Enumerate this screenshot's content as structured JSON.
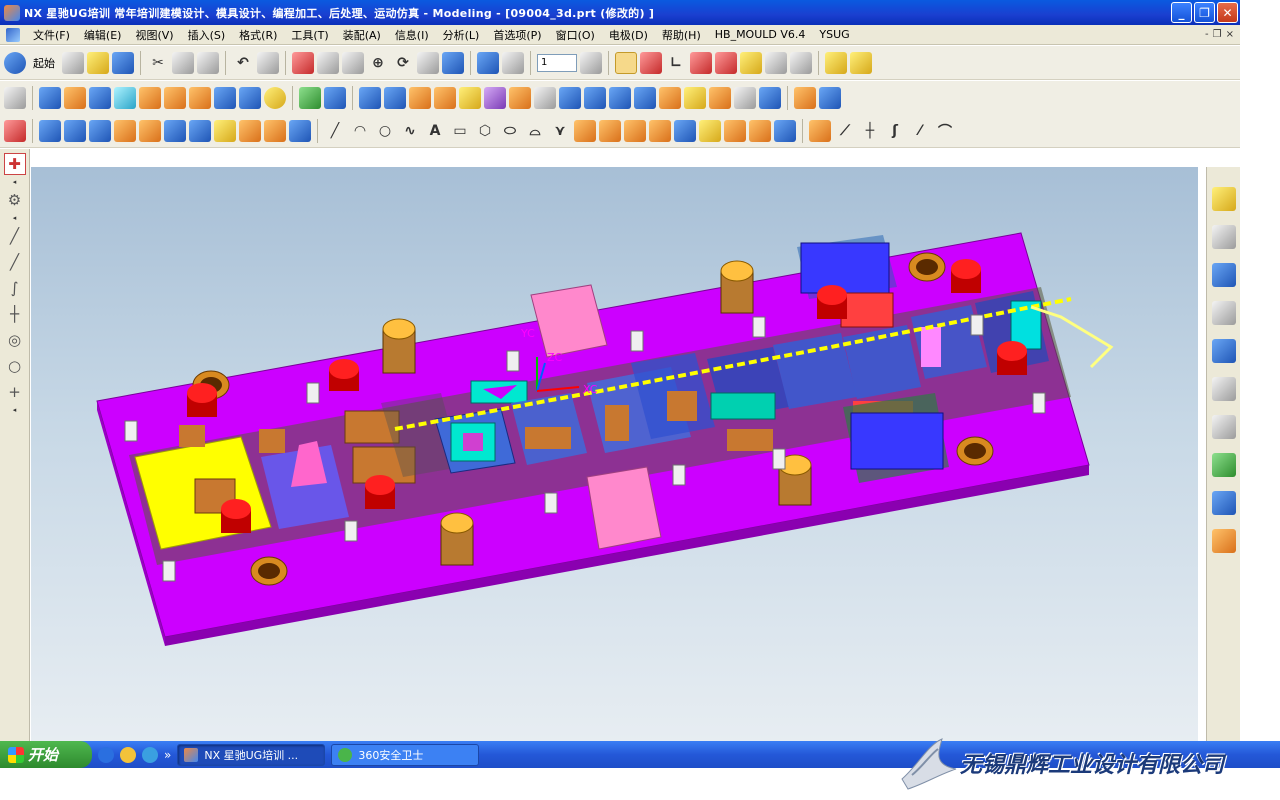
{
  "window": {
    "title": "NX 星驰UG培训   常年培训建模设计、模具设计、编程加工、后处理、运动仿真 - Modeling - [09004_3d.prt  (修改的) ]",
    "controls": {
      "minimize": "_",
      "restore": "❐",
      "close": "✕"
    }
  },
  "menu": {
    "items": [
      "文件(F)",
      "编辑(E)",
      "视图(V)",
      "插入(S)",
      "格式(R)",
      "工具(T)",
      "装配(A)",
      "信息(I)",
      "分析(L)",
      "首选项(P)",
      "窗口(O)",
      "电极(D)",
      "帮助(H)",
      "HB_MOULD V6.4",
      "YSUG"
    ],
    "doc_controls": {
      "minimize": "-",
      "restore": "❐",
      "close": "×"
    }
  },
  "toolbar": {
    "start_label": "起始",
    "layer_value": "1"
  },
  "graphics": {
    "wcs": {
      "x_label": "XC",
      "y_label": "YC",
      "z_label": "ZC"
    }
  },
  "taskbar": {
    "start_label": "开始",
    "tasks": [
      {
        "label": "NX 星驰UG培训  ...",
        "active": true
      },
      {
        "label": "360安全卫士",
        "active": false
      }
    ],
    "chevron": "»"
  },
  "watermark": {
    "text": "无锡鼎辉工业设计有限公司"
  }
}
